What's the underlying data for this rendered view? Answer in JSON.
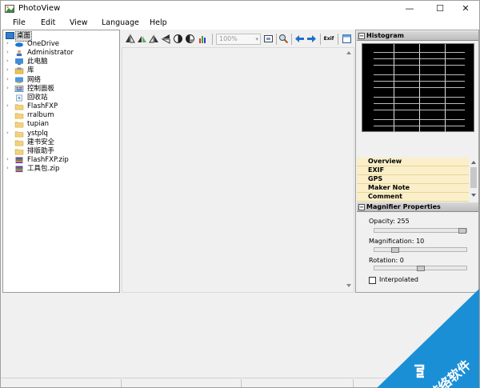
{
  "window": {
    "title": "PhotoView",
    "minimize_glyph": "—",
    "maximize_glyph": "☐",
    "close_glyph": "✕"
  },
  "menu": [
    "File",
    "Edit",
    "View",
    "Language",
    "Help"
  ],
  "tree": {
    "root_label": "桌面",
    "items": [
      {
        "label": "OneDrive",
        "icon": "cloud-icon",
        "expandable": true
      },
      {
        "label": "Administrator",
        "icon": "user-icon",
        "expandable": true
      },
      {
        "label": "此电脑",
        "icon": "computer-icon",
        "expandable": true
      },
      {
        "label": "库",
        "icon": "library-icon",
        "expandable": true
      },
      {
        "label": "网络",
        "icon": "network-icon",
        "expandable": true
      },
      {
        "label": "控制面板",
        "icon": "control-panel-icon",
        "expandable": true
      },
      {
        "label": "回收站",
        "icon": "recycle-bin-icon",
        "expandable": false
      },
      {
        "label": "FlashFXP",
        "icon": "folder-icon",
        "expandable": true
      },
      {
        "label": "rralbum",
        "icon": "folder-icon",
        "expandable": false
      },
      {
        "label": "tupian",
        "icon": "folder-icon",
        "expandable": false
      },
      {
        "label": "ystplq",
        "icon": "folder-icon",
        "expandable": true
      },
      {
        "label": "建书安全",
        "icon": "folder-icon",
        "expandable": false
      },
      {
        "label": "排版助手",
        "icon": "folder-icon",
        "expandable": false
      },
      {
        "label": "FlashFXP.zip",
        "icon": "zip-icon",
        "expandable": true
      },
      {
        "label": "工具包.zip",
        "icon": "zip-icon",
        "expandable": true
      }
    ]
  },
  "toolbar": {
    "zoom_value": "100%",
    "zoom_arrow": "▾",
    "exif_label": "Exif"
  },
  "right_panel": {
    "histogram_title": "Histogram",
    "metadata_sections": [
      "Overview",
      "EXIF",
      "GPS",
      "Maker Note",
      "Comment"
    ],
    "magnifier_title": "Magnifier Properties",
    "opacity_label": "Opacity: 255",
    "opacity_level": 1.0,
    "magnification_label": "Magnification: 10",
    "magnification_level": 0.2,
    "rotation_label": "Rotation: 0",
    "rotation_level": 0.5,
    "interpolated_label": "Interpolated",
    "interpolated_checked": false,
    "collapse_glyph": "−"
  },
  "watermark": {
    "text": "游络软件"
  },
  "colors": {
    "watermark_blue": "#1a8fd6",
    "meta_row_bg": "#faefc8",
    "histogram_bg": "#000000"
  }
}
